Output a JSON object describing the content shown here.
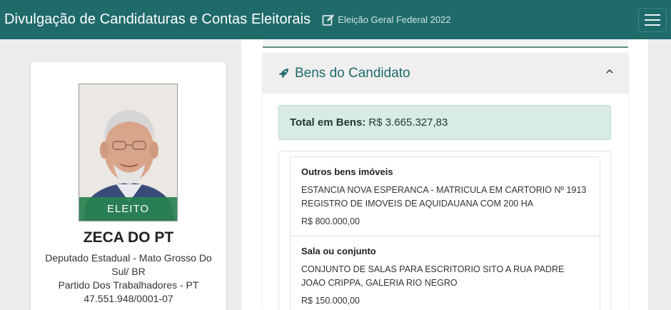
{
  "header": {
    "title": "Divulgação de Candidaturas e Contas Eleitorais",
    "subtitle": "Eleição Geral Federal 2022"
  },
  "candidate": {
    "status": "ELEITO",
    "name": "ZECA DO PT",
    "office": "Deputado Estadual - Mato Grosso Do Sul/ BR",
    "party": "Partido Dos Trabalhadores - PT",
    "cnpj": "47.551.948/0001-07"
  },
  "assets": {
    "section_title": "Bens do Candidato",
    "total_label": "Total em Bens:",
    "total_value": "R$ 3.665.327,83",
    "items": [
      {
        "type": "Outros bens imóveis",
        "description": "ESTANCIA NOVA ESPERANCA - MATRICULA EM CARTORIO Nº 1913 REGISTRO DE IMOVEIS DE AQUIDAUANA COM 200 HA",
        "value": "R$ 800.000,00"
      },
      {
        "type": "Sala ou conjunto",
        "description": "CONJUNTO DE SALAS PARA ESCRITORIO SITO A RUA PADRE JOAO CRIPPA, GALERIA RIO NEGRO",
        "value": "R$ 150.000,00"
      }
    ]
  },
  "colors": {
    "header_bg": "#1f6b6a",
    "accent_text": "#1f6b6a",
    "badge_bg": "#28824f",
    "total_bg": "#d8ece3"
  },
  "icons": {
    "edit": "edit-icon",
    "menu": "hamburger-menu-icon",
    "section": "rocket-icon",
    "collapse": "chevron-up-icon"
  }
}
